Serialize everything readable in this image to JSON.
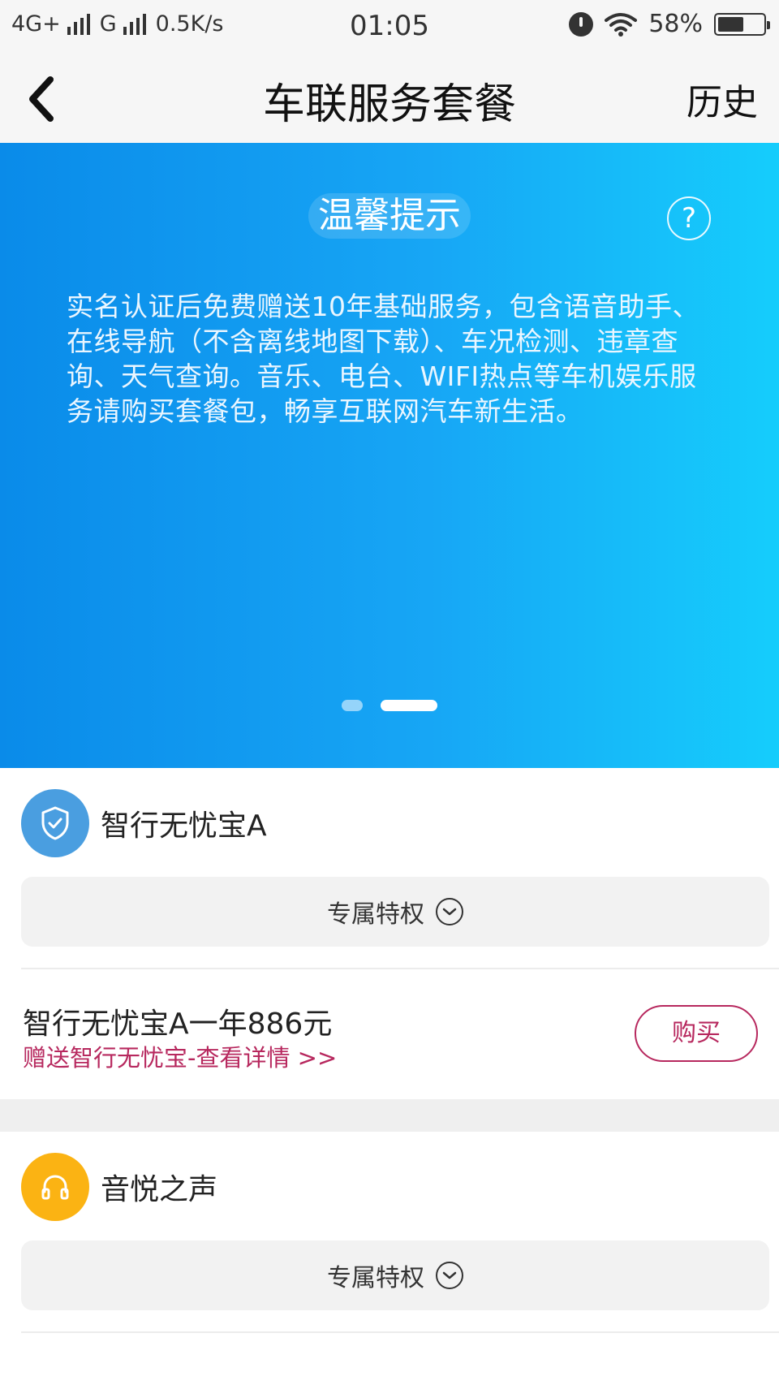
{
  "status_bar": {
    "network_1": "4G+",
    "network_2": "G",
    "speed": "0.5K/s",
    "time": "01:05",
    "battery": "58%",
    "battery_level": 0.58
  },
  "nav": {
    "back_icon": "chevron-left-icon",
    "title": "车联服务套餐",
    "history": "历史"
  },
  "banner": {
    "title": "温馨提示",
    "help_symbol": "?",
    "text": "实名认证后免费赠送10年基础服务，包含语音助手、在线导航（不含离线地图下载）、车况检测、违章查询、天气查询。音乐、电台、WIFI热点等车机娱乐服务请购买套餐包，畅享互联网汽车新生活。",
    "page_count": 2,
    "active_page": 2
  },
  "packages": [
    {
      "name": "智行无忧宝A",
      "icon": "shield-check-icon",
      "color": "#4a9ee0",
      "privilege_label": "专属特权",
      "offer_title": "智行无忧宝A一年886元",
      "offer_gift": "赠送智行无忧宝-查看详情 >>",
      "buy_label": "购买"
    },
    {
      "name": "音悦之声",
      "icon": "headphones-icon",
      "color": "#fbb313",
      "privilege_label": "专属特权"
    }
  ],
  "colors": {
    "accent": "#b7285e",
    "banner_start": "#0a8be9",
    "banner_end": "#15cdfc"
  }
}
